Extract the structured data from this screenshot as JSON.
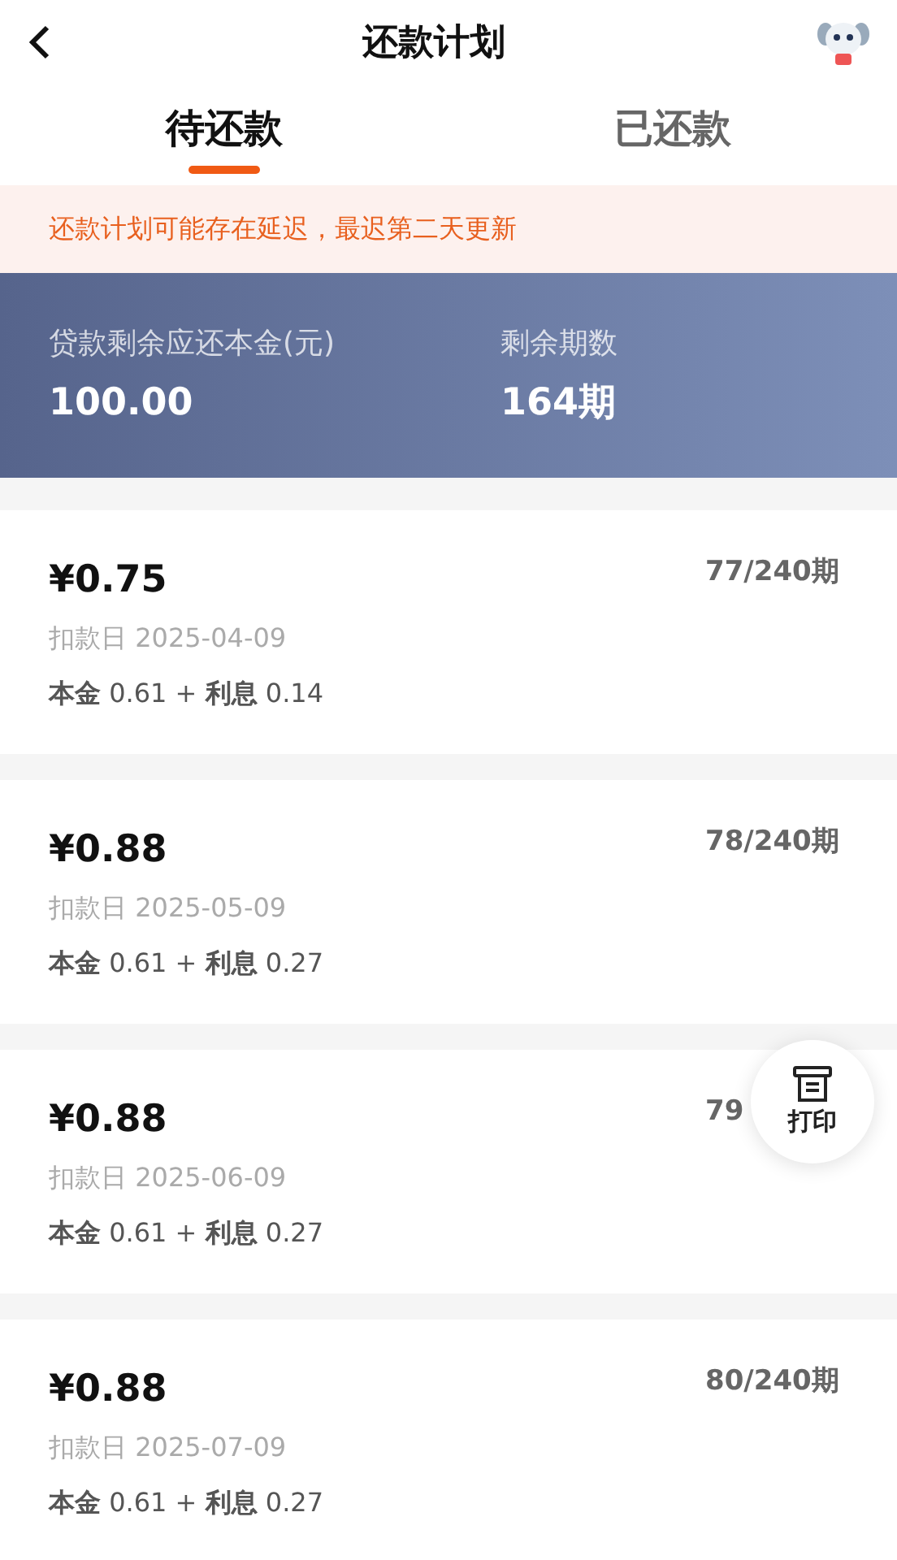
{
  "header": {
    "title": "还款计划"
  },
  "tabs": [
    {
      "label": "待还款",
      "selected": true
    },
    {
      "label": "已还款",
      "selected": false
    }
  ],
  "notice": "还款计划可能存在延迟，最迟第二天更新",
  "summary": [
    {
      "label": "贷款剩余应还本金(元)",
      "value": "100.00"
    },
    {
      "label": "剩余期数",
      "value": "164期"
    }
  ],
  "installments": [
    {
      "amount": "¥0.75",
      "period": "77/240期",
      "date": "扣款日 2025-04-09",
      "breakdown": "**本金** 0.61 + **利息** 0.14"
    },
    {
      "amount": "¥0.88",
      "period": "78/240期",
      "date": "扣款日 2025-05-09",
      "breakdown": "**本金** 0.61 + **利息** 0.27"
    },
    {
      "amount": "¥0.88",
      "period": "79",
      "date": "扣款日 2025-06-09",
      "breakdown": "**本金** 0.61 + **利息** 0.27"
    },
    {
      "amount": "¥0.88",
      "period": "80/240期",
      "date": "扣款日 2025-07-09",
      "breakdown": "**本金** 0.61 + **利息** 0.27"
    }
  ],
  "print_button": {
    "label": "打印"
  }
}
